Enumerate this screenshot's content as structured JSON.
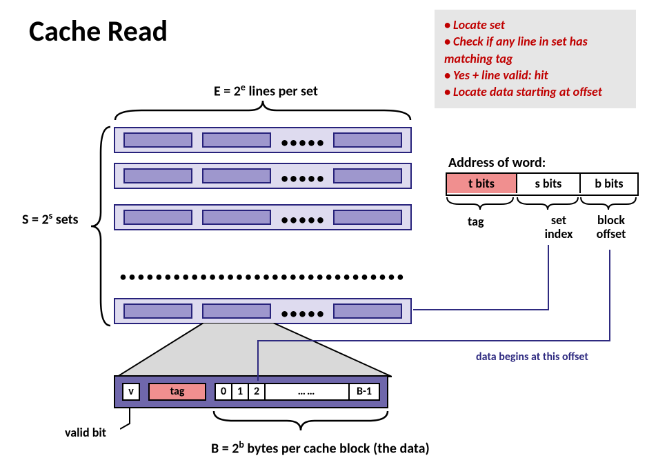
{
  "title": "Cache Read",
  "algo": {
    "b1": "• Locate set",
    "b2": "• Check if any line in set has matching tag",
    "b3": "• Yes + line valid: hit",
    "b4": "• Locate data starting at offset"
  },
  "labels": {
    "E_pre": "E = 2",
    "E_exp": "e",
    "E_post": " lines per set",
    "S_pre": "S = 2",
    "S_exp": "s",
    "S_post": " sets",
    "B_pre": "B = 2",
    "B_exp": "b",
    "B_post": " bytes per cache block (the data)"
  },
  "detail": {
    "v": "v",
    "tag": "tag",
    "b0": "0",
    "b1": "1",
    "b2": "2",
    "dots": "……",
    "bn": "B-1",
    "valid": "valid bit"
  },
  "addr": {
    "header": "Address of word:",
    "t": "t bits",
    "s": "s bits",
    "b": "b bits",
    "tag": "tag",
    "setidx": "set index",
    "blkoff": "block offset"
  },
  "offset_note": "data begins at this offset"
}
